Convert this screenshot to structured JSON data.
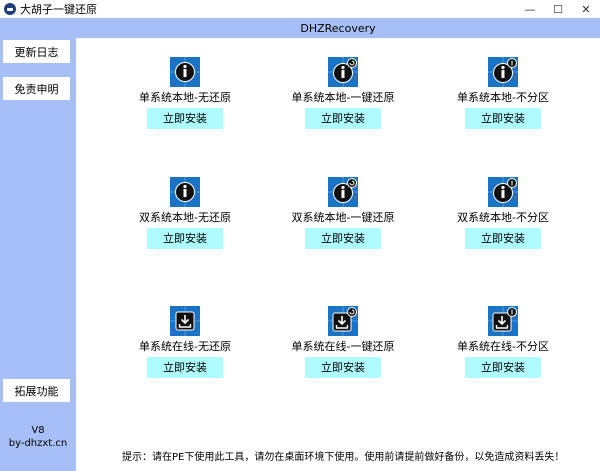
{
  "window": {
    "title": "大胡子一键还原",
    "minimize": "—",
    "maximize": "☐",
    "close": "✕"
  },
  "header": {
    "title": "DHZRecovery"
  },
  "sidebar": {
    "changelog": "更新日志",
    "disclaimer": "免责申明",
    "extensions": "拓展功能",
    "version": "V8",
    "site": "by-dhzxt.cn"
  },
  "tiles": [
    {
      "label": "单系统本地-无还原",
      "button": "立即安装",
      "icon": "info-icon"
    },
    {
      "label": "单系统本地-一键还原",
      "button": "立即安装",
      "icon": "info-restore-icon"
    },
    {
      "label": "单系统本地-不分区",
      "button": "立即安装",
      "icon": "info-partition-icon"
    },
    {
      "label": "双系统本地-无还原",
      "button": "立即安装",
      "icon": "info-icon"
    },
    {
      "label": "双系统本地-一键还原",
      "button": "立即安装",
      "icon": "info-restore-icon"
    },
    {
      "label": "双系统本地-不分区",
      "button": "立即安装",
      "icon": "info-partition-icon"
    },
    {
      "label": "单系统在线-无还原",
      "button": "立即安装",
      "icon": "download-icon"
    },
    {
      "label": "单系统在线-一键还原",
      "button": "立即安装",
      "icon": "download-restore-icon"
    },
    {
      "label": "单系统在线-不分区",
      "button": "立即安装",
      "icon": "download-partition-icon"
    }
  ],
  "tip": "提示：请在PE下使用此工具，请勿在桌面环境下使用。使用前请提前做好备份，以免造成资料丢失！",
  "colors": {
    "sidebar": "#a6bff6",
    "button": "#aefcfd",
    "icon": "#1b73c4"
  }
}
